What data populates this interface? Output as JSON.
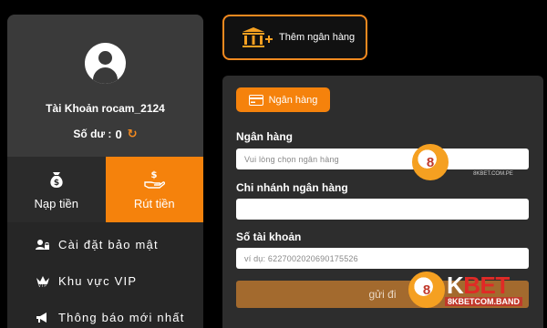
{
  "profile": {
    "username": "Tài Khoản rocam_2124",
    "balance_label": "Số dư :",
    "balance_value": "0"
  },
  "actions": {
    "deposit": "Nạp tiền",
    "withdraw": "Rút tiền"
  },
  "menu": {
    "items": [
      {
        "label": "Cài đặt bảo mật",
        "icon": "user-lock-icon"
      },
      {
        "label": "Khu vực VIP",
        "icon": "crown-icon"
      },
      {
        "label": "Thông báo mới nhất",
        "icon": "megaphone-icon"
      }
    ]
  },
  "add_bank": {
    "label": "Thêm ngân hàng",
    "icon": "bank-add-icon"
  },
  "form": {
    "tab_label": "Ngân hàng",
    "bank_label": "Ngân hàng",
    "bank_placeholder": "Vui lòng chọn ngân hàng",
    "branch_label": "Chi nhánh ngân hàng",
    "branch_value": "",
    "account_label": "Số tài khoản",
    "account_placeholder": "ví dụ: 6227002020690175526",
    "submit_label": "gửi đi"
  },
  "watermark": {
    "brand_8": "8",
    "brand_k": "K",
    "brand_bet": "BET",
    "sub_small": "8KBET.COM.PE",
    "sub_band": "8KBETCOM.BAND"
  },
  "colors": {
    "accent": "#f5820c",
    "panel": "#2d2d2d",
    "sidebar": "#262626",
    "submit": "#a36a2e"
  }
}
